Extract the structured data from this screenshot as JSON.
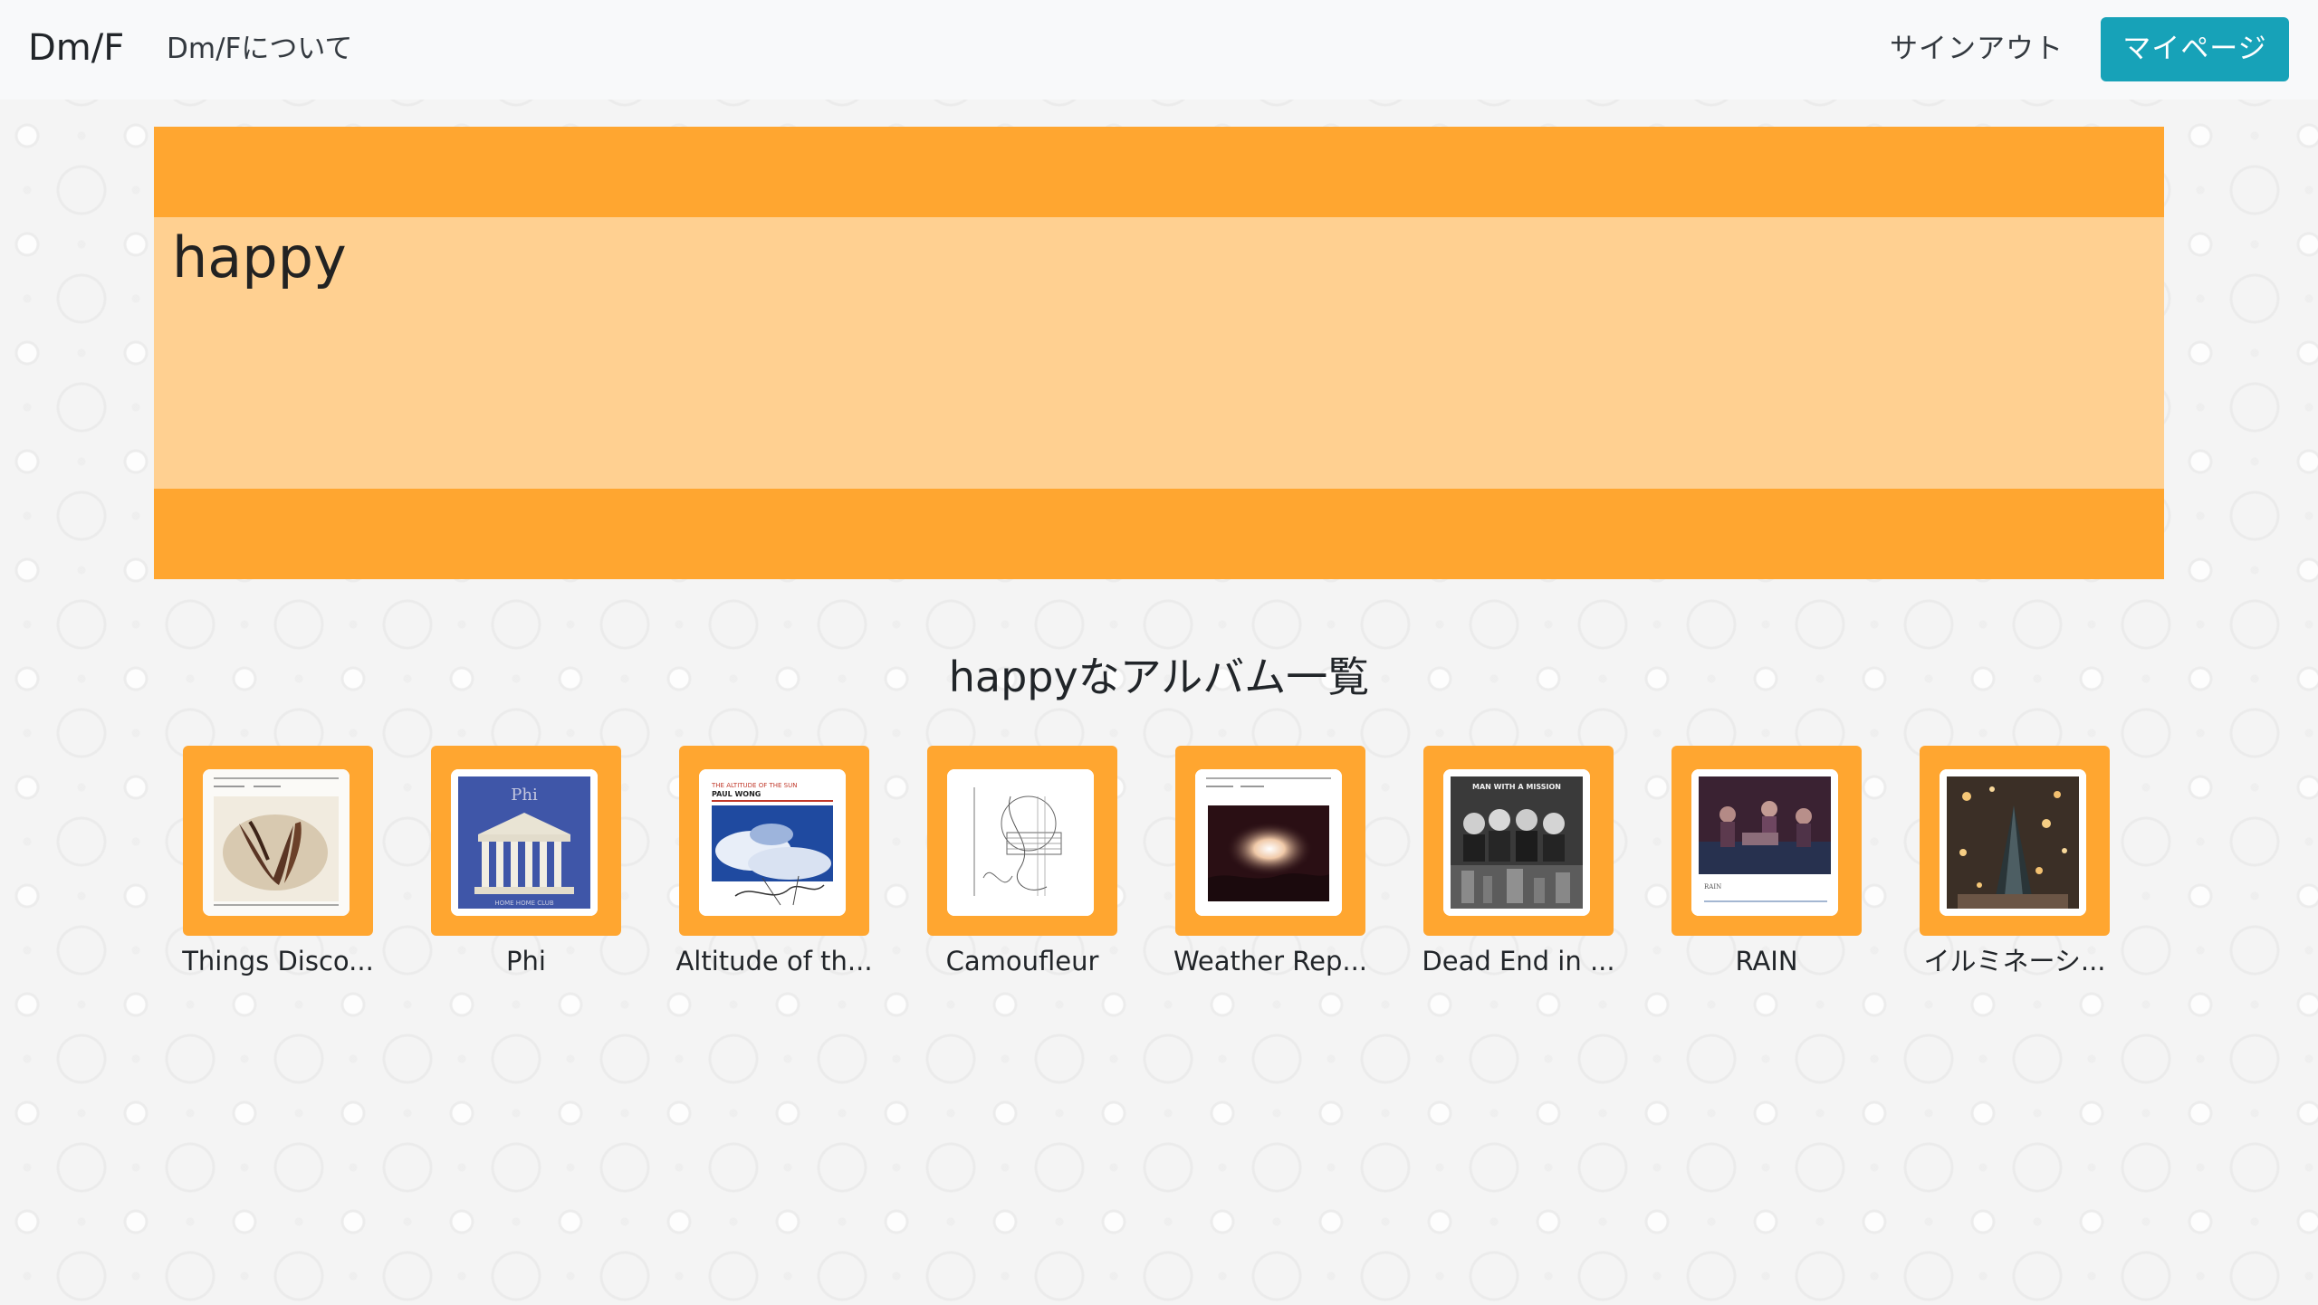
{
  "navbar": {
    "brand": "Dm/F",
    "about": "Dm/Fについて",
    "signout": "サインアウト",
    "mypage": "マイページ"
  },
  "hero": {
    "title": "happy"
  },
  "albums_section": {
    "heading": "happyなアルバム一覧",
    "albums": [
      {
        "title": "Things Disco..."
      },
      {
        "title": "Phi",
        "cover_text": "Phi",
        "cover_caption": "HOME HOME CLUB"
      },
      {
        "title": "Altitude of th...",
        "cover_text": "THE ALTITUDE OF THE SUN",
        "cover_caption": "PAUL WONG"
      },
      {
        "title": "Camoufleur"
      },
      {
        "title": "Weather Rep..."
      },
      {
        "title": "Dead End in ...",
        "cover_text": "MAN WITH A MISSION"
      },
      {
        "title": "RAIN"
      },
      {
        "title": "イルミネーシ..."
      }
    ]
  },
  "colors": {
    "accent_orange": "#ffa630",
    "light_orange": "#ffd091",
    "button_teal": "#17a2b8"
  }
}
